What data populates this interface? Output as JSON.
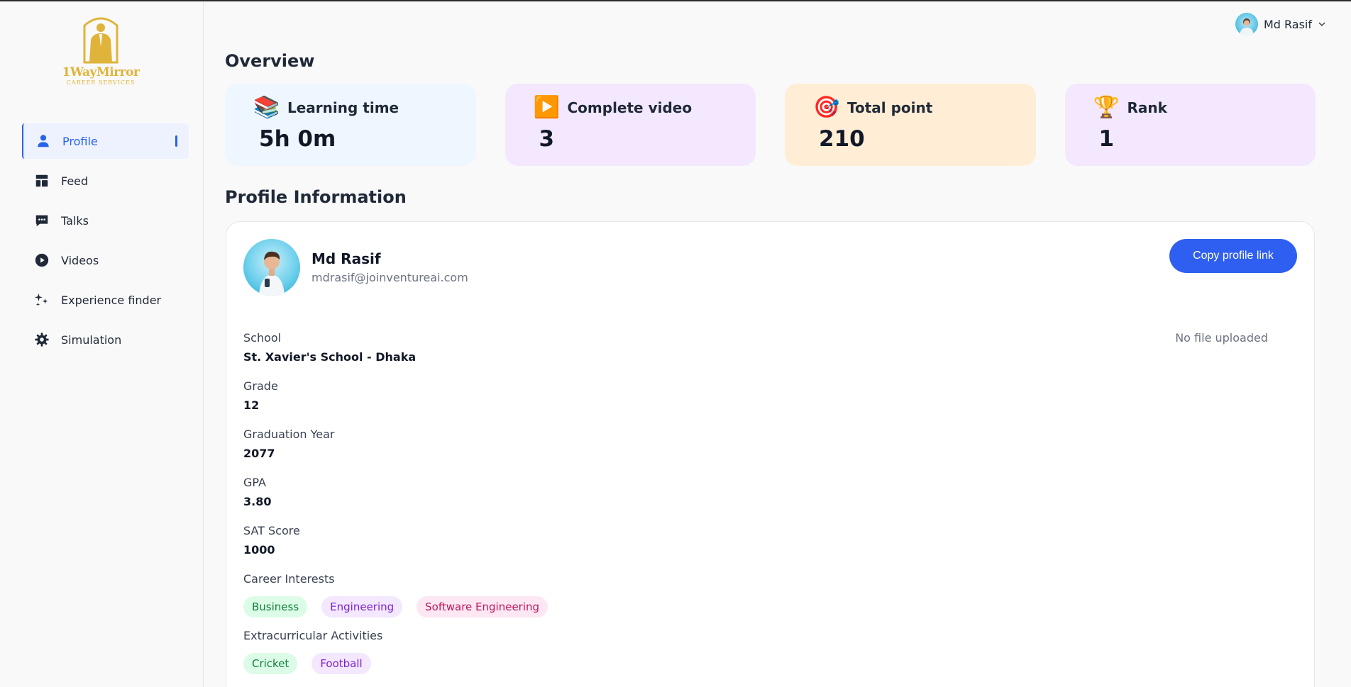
{
  "brand": {
    "logo_text": "1WayMirror",
    "logo_subtext": "CAREER SERVICES"
  },
  "sidebar": {
    "items": [
      {
        "label": "Profile",
        "icon": "user-icon",
        "active": true
      },
      {
        "label": "Feed",
        "icon": "layout-icon",
        "active": false
      },
      {
        "label": "Talks",
        "icon": "chat-icon",
        "active": false
      },
      {
        "label": "Videos",
        "icon": "play-icon",
        "active": false
      },
      {
        "label": "Experience finder",
        "icon": "sparkles-icon",
        "active": false
      },
      {
        "label": "Simulation",
        "icon": "gear-icon",
        "active": false
      }
    ]
  },
  "header": {
    "user_name": "Md Rasif",
    "dropdown_icon": "chevron-down-icon"
  },
  "overview": {
    "title": "Overview",
    "stats": [
      {
        "label": "Learning time",
        "value": "5h 0m",
        "emoji": "📚",
        "bg": "#eef6ff"
      },
      {
        "label": "Complete video",
        "value": "3",
        "emoji": "▶️",
        "bg": "#f3e8ff"
      },
      {
        "label": "Total point",
        "value": "210",
        "emoji": "🎯",
        "bg": "#ffedd5"
      },
      {
        "label": "Rank",
        "value": "1",
        "emoji": "🏆",
        "bg": "#f3e8ff"
      }
    ]
  },
  "profile": {
    "title": "Profile Information",
    "name": "Md Rasif",
    "email": "mdrasif@joinventureai.com",
    "copy_button": "Copy profile link",
    "file_status": "No file uploaded",
    "fields": [
      {
        "label": "School",
        "value": "St. Xavier's School - Dhaka"
      },
      {
        "label": "Grade",
        "value": "12"
      },
      {
        "label": "Graduation Year",
        "value": "2077"
      },
      {
        "label": "GPA",
        "value": "3.80"
      },
      {
        "label": "SAT Score",
        "value": "1000"
      }
    ],
    "career_interests": {
      "label": "Career Interests",
      "tags": [
        {
          "text": "Business",
          "bg": "#dcfce7",
          "color": "#15803d"
        },
        {
          "text": "Engineering",
          "bg": "#f3e8ff",
          "color": "#7e22ce"
        },
        {
          "text": "Software Engineering",
          "bg": "#fce7f3",
          "color": "#be185d"
        }
      ]
    },
    "extracurricular": {
      "label": "Extracurricular Activities",
      "tags": [
        {
          "text": "Cricket",
          "bg": "#dcfce7",
          "color": "#15803d"
        },
        {
          "text": "Football",
          "bg": "#f3e8ff",
          "color": "#7e22ce"
        }
      ]
    }
  },
  "colors": {
    "accent": "#2563eb",
    "button": "#2f5ff0",
    "logo_gold": "#e0b43a"
  }
}
